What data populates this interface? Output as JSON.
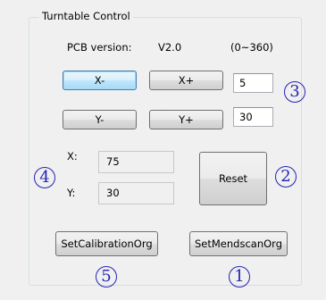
{
  "group": {
    "title": "Turntable Control"
  },
  "pcb": {
    "label": "PCB version:",
    "version": "V2.0",
    "range": "(0~360)"
  },
  "buttons": {
    "x_minus": "X-",
    "x_plus": "X+",
    "y_minus": "Y-",
    "y_plus": "Y+",
    "reset": "Reset",
    "set_calibration_org": "SetCalibrationOrg",
    "set_mendscan_org": "SetMendscanOrg"
  },
  "inputs": {
    "x_step": "5",
    "y_step": "30"
  },
  "position": {
    "x_label": "X:",
    "x_value": "75",
    "y_label": "Y:",
    "y_value": "30"
  },
  "markers": {
    "m1": "1",
    "m2": "2",
    "m3": "3",
    "m4": "4",
    "m5": "5"
  },
  "colors": {
    "marker": "#2323b4",
    "focus_border": "#3c7fb1"
  }
}
